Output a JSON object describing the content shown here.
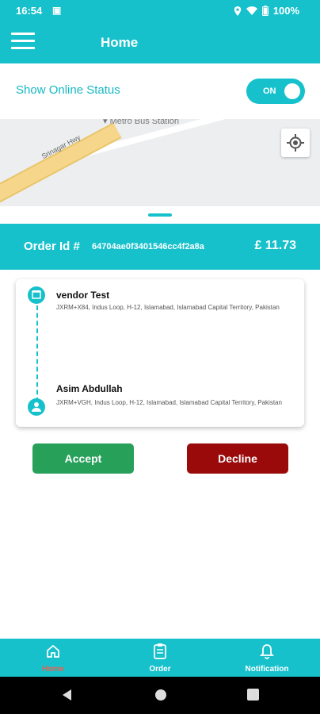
{
  "status_bar": {
    "time": "16:54",
    "battery": "100%"
  },
  "app_bar": {
    "title": "Home"
  },
  "online_status": {
    "label": "Show Online Status",
    "toggle_text": "ON",
    "enabled": true
  },
  "map": {
    "road_label": "Srinagar Hwy",
    "station_label": "Metro Bus Station"
  },
  "order": {
    "label": "Order Id #",
    "id": "64704ae0f3401546cc4f2a8a",
    "price": "£ 11.73"
  },
  "pickup": {
    "name": "vendor Test",
    "address": "JXRM+X84, Indus Loop, H-12, Islamabad, Islamabad Capital Territory, Pakistan"
  },
  "dropoff": {
    "name": "Asim Abdullah",
    "address": "JXRM+VGH, Indus Loop, H-12, Islamabad, Islamabad Capital Territory, Pakistan"
  },
  "actions": {
    "accept": "Accept",
    "decline": "Decline"
  },
  "bottom_nav": {
    "home": "Home",
    "order": "Order",
    "notification": "Notification"
  },
  "colors": {
    "brand": "#16c1cc",
    "accept": "#27a05a",
    "decline": "#9a0a0a",
    "active_tab": "#ef5f4b"
  },
  "icons": [
    "menu-icon",
    "location-target-icon",
    "store-pin-icon",
    "person-pin-icon",
    "home-icon",
    "clipboard-icon",
    "bell-icon",
    "back-icon",
    "home-circle-icon",
    "recents-icon"
  ]
}
